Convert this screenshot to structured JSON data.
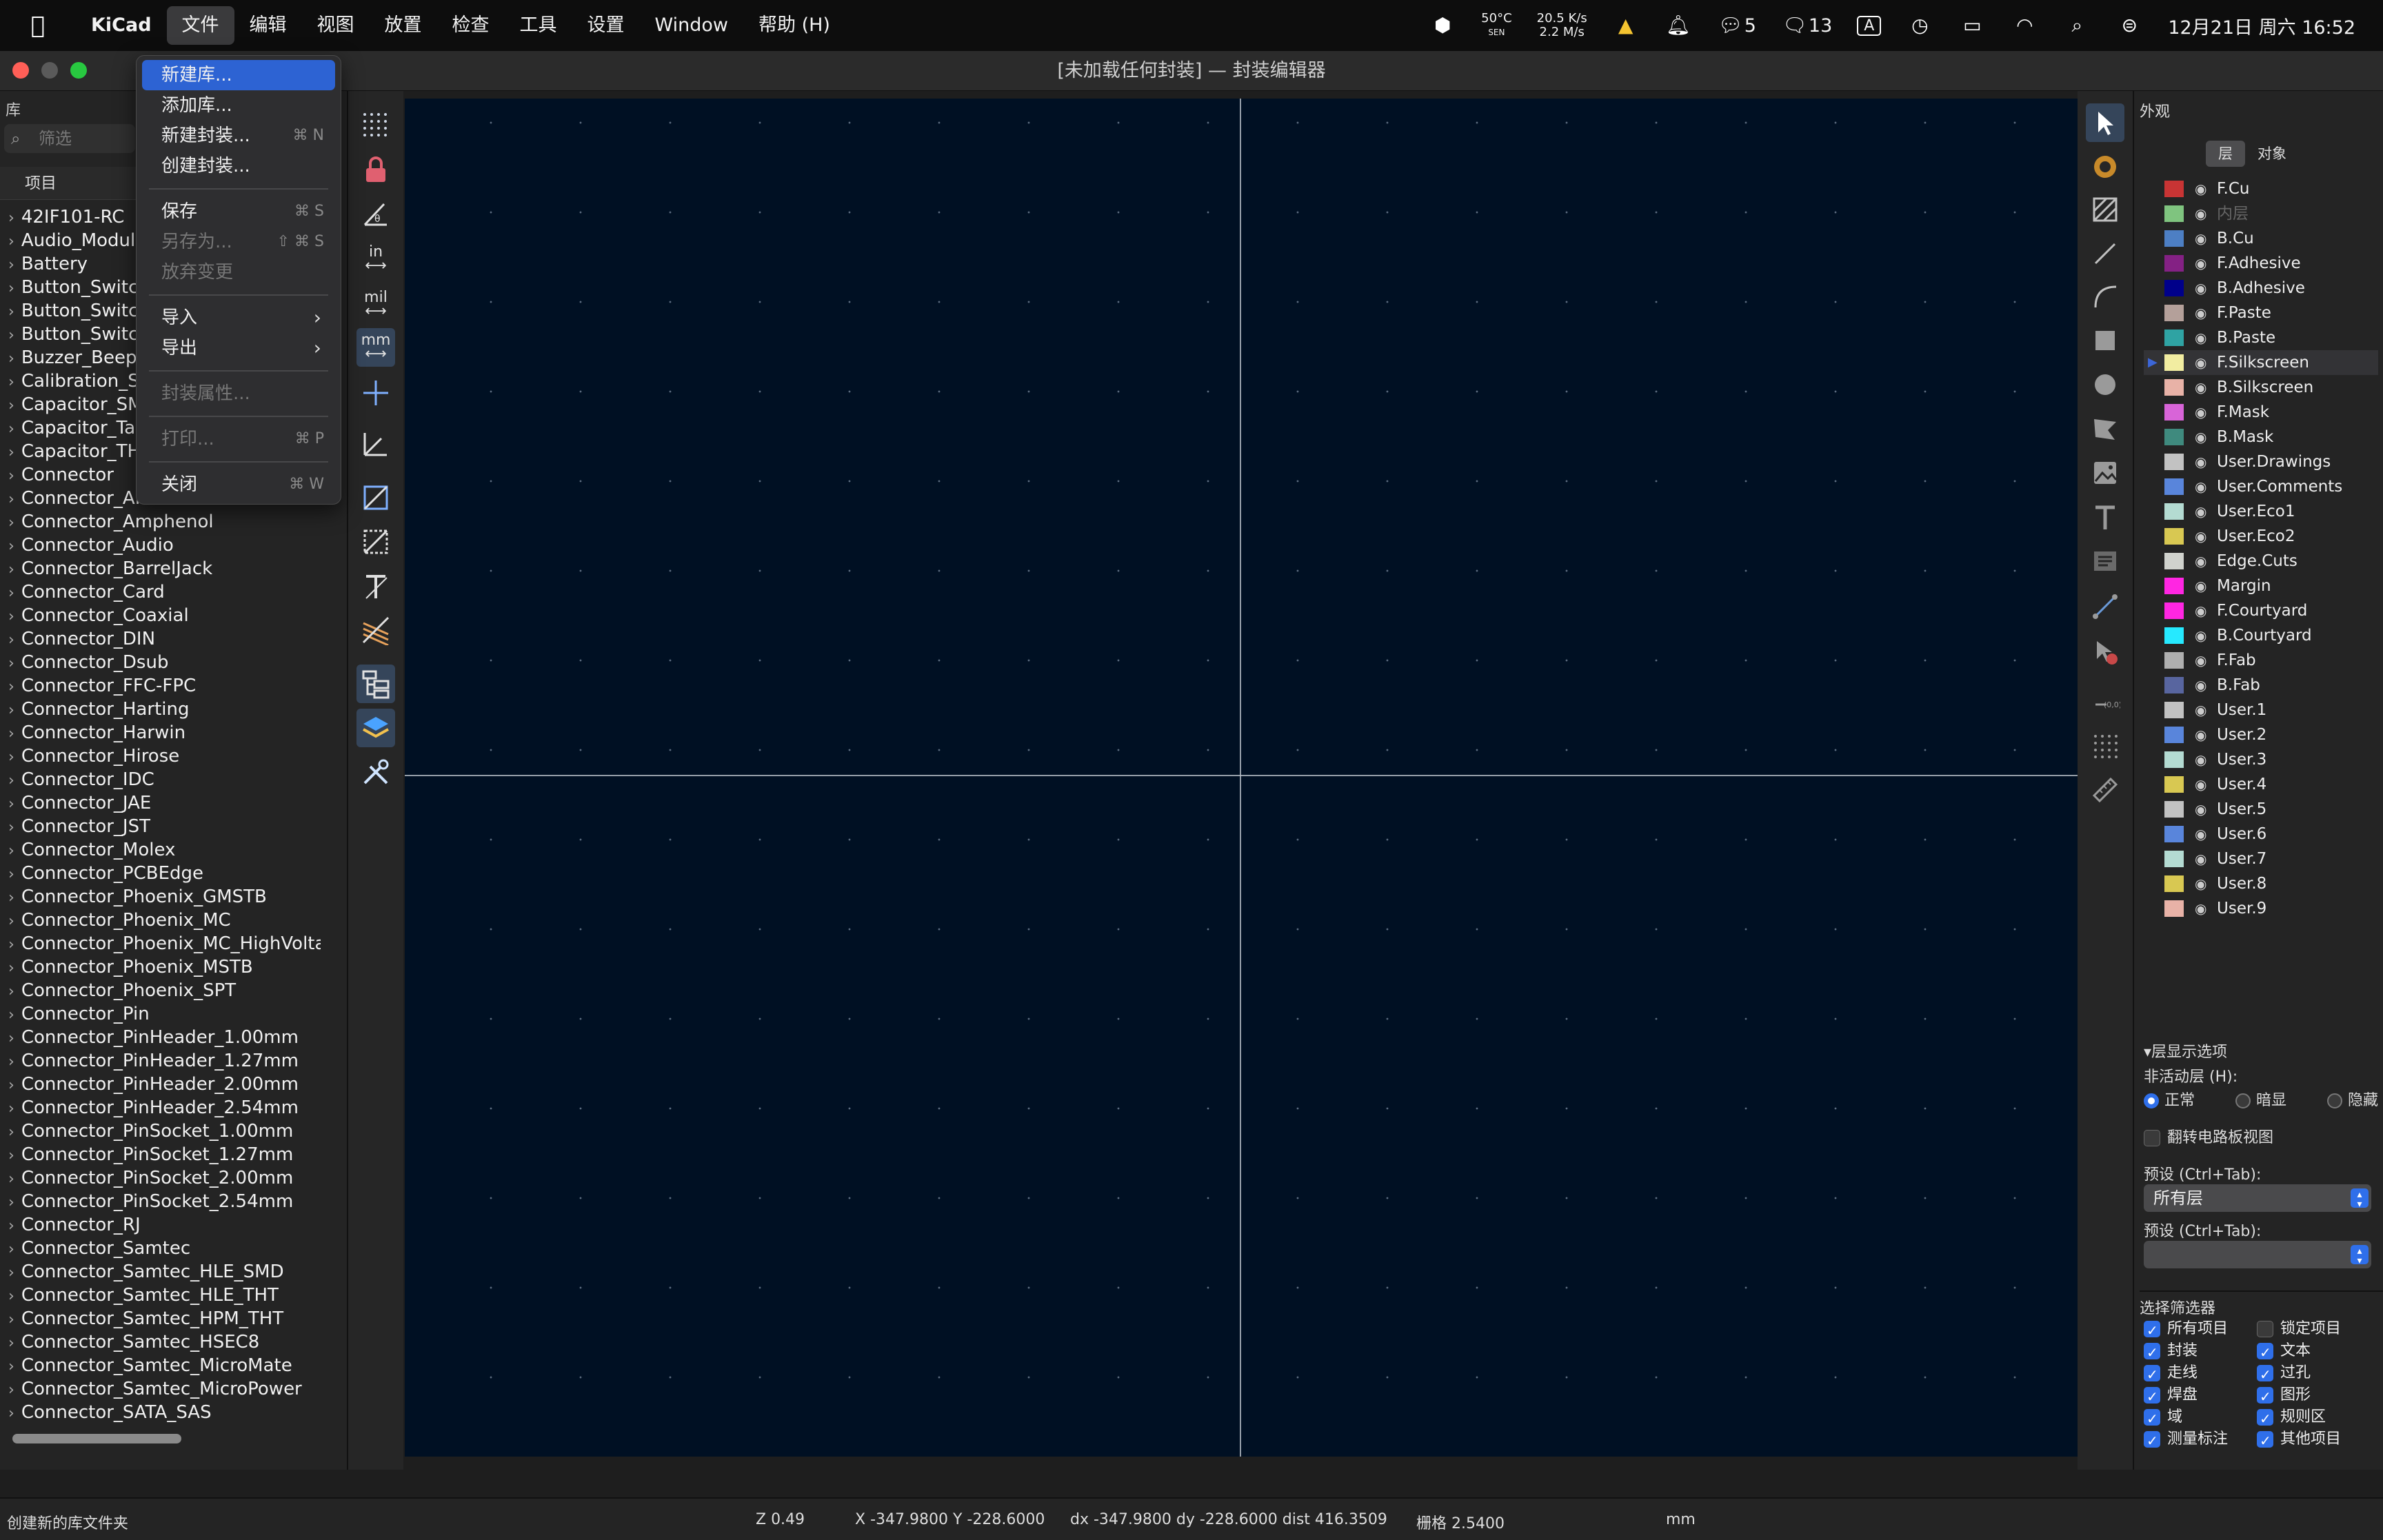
{
  "menubar": {
    "app": "KiCad",
    "items": [
      "文件",
      "编辑",
      "视图",
      "放置",
      "检查",
      "工具",
      "设置",
      "Window",
      "帮助 (H)"
    ],
    "status": {
      "temp": "50°C",
      "temp_sub": "SEN",
      "net_up": "20.5 K/s",
      "net_down": "2.2 M/s",
      "wechat_count": "5",
      "chat_count": "13",
      "input": "A",
      "datetime": "12月21日 周六  16:52"
    }
  },
  "window": {
    "title": "[未加载任何封装] — 封装编辑器"
  },
  "library": {
    "title": "库",
    "filter_placeholder": "筛选",
    "column": "项目",
    "items": [
      "42IF101-RC",
      "Audio_Module",
      "Battery",
      "Button_Switch",
      "Button_Switch",
      "Button_Switch",
      "Buzzer_Beeper",
      "Calibration_Scale",
      "Capacitor_SMD",
      "Capacitor_Tantalum",
      "Capacitor_THT",
      "Connector",
      "Connector_AMASS",
      "Connector_Amphenol",
      "Connector_Audio",
      "Connector_BarrelJack",
      "Connector_Card",
      "Connector_Coaxial",
      "Connector_DIN",
      "Connector_Dsub",
      "Connector_FFC-FPC",
      "Connector_Harting",
      "Connector_Harwin",
      "Connector_Hirose",
      "Connector_IDC",
      "Connector_JAE",
      "Connector_JST",
      "Connector_Molex",
      "Connector_PCBEdge",
      "Connector_Phoenix_GMSTB",
      "Connector_Phoenix_MC",
      "Connector_Phoenix_MC_HighVoltage",
      "Connector_Phoenix_MSTB",
      "Connector_Phoenix_SPT",
      "Connector_Pin",
      "Connector_PinHeader_1.00mm",
      "Connector_PinHeader_1.27mm",
      "Connector_PinHeader_2.00mm",
      "Connector_PinHeader_2.54mm",
      "Connector_PinSocket_1.00mm",
      "Connector_PinSocket_1.27mm",
      "Connector_PinSocket_2.00mm",
      "Connector_PinSocket_2.54mm",
      "Connector_RJ",
      "Connector_Samtec",
      "Connector_Samtec_HLE_SMD",
      "Connector_Samtec_HLE_THT",
      "Connector_Samtec_HPM_THT",
      "Connector_Samtec_HSEC8",
      "Connector_Samtec_MicroMate",
      "Connector_Samtec_MicroPower",
      "Connector_SATA_SAS"
    ]
  },
  "file_menu": {
    "items": [
      {
        "label": "新建库...",
        "shortcut": "",
        "state": "selected"
      },
      {
        "label": "添加库...",
        "shortcut": "",
        "state": "normal"
      },
      {
        "label": "新建封装...",
        "shortcut": "⌘ N",
        "state": "normal"
      },
      {
        "label": "创建封装...",
        "shortcut": "",
        "state": "normal"
      },
      {
        "label": "保存",
        "shortcut": "⌘ S",
        "state": "normal"
      },
      {
        "label": "另存为...",
        "shortcut": "⇧ ⌘ S",
        "state": "disabled"
      },
      {
        "label": "放弃变更",
        "shortcut": "",
        "state": "disabled"
      },
      {
        "label": "导入",
        "shortcut": "",
        "state": "submenu"
      },
      {
        "label": "导出",
        "shortcut": "",
        "state": "submenu"
      },
      {
        "label": "封装属性...",
        "shortcut": "",
        "state": "disabled"
      },
      {
        "label": "打印...",
        "shortcut": "⌘ P",
        "state": "disabled"
      },
      {
        "label": "关闭",
        "shortcut": "⌘ W",
        "state": "normal"
      }
    ]
  },
  "left_tools": {
    "in_label": "in",
    "mil_label": "mil",
    "mm_label": "mm"
  },
  "appearance": {
    "title": "外观",
    "tabs": [
      "层",
      "对象"
    ],
    "layers": [
      {
        "name": "F.Cu",
        "color": "#c83434"
      },
      {
        "name": "内层",
        "color": "#7fc47f",
        "dim": true
      },
      {
        "name": "B.Cu",
        "color": "#4d7fc4"
      },
      {
        "name": "F.Adhesive",
        "color": "#842184"
      },
      {
        "name": "B.Adhesive",
        "color": "#00008a"
      },
      {
        "name": "F.Paste",
        "color": "#b4a09a"
      },
      {
        "name": "B.Paste",
        "color": "#2fa3a3"
      },
      {
        "name": "F.Silkscreen",
        "color": "#f2eda1",
        "selected": true
      },
      {
        "name": "B.Silkscreen",
        "color": "#e8b2a7"
      },
      {
        "name": "F.Mask",
        "color": "#d864d8"
      },
      {
        "name": "B.Mask",
        "color": "#3f8a7e"
      },
      {
        "name": "User.Drawings",
        "color": "#c2c2c2"
      },
      {
        "name": "User.Comments",
        "color": "#5985db"
      },
      {
        "name": "User.Eco1",
        "color": "#b4dbd2"
      },
      {
        "name": "User.Eco2",
        "color": "#d8c852"
      },
      {
        "name": "Edge.Cuts",
        "color": "#d0d2cd"
      },
      {
        "name": "Margin",
        "color": "#ff26e2"
      },
      {
        "name": "F.Courtyard",
        "color": "#ff26e2"
      },
      {
        "name": "B.Courtyard",
        "color": "#26e9ff"
      },
      {
        "name": "F.Fab",
        "color": "#afafaf"
      },
      {
        "name": "B.Fab",
        "color": "#58659f"
      },
      {
        "name": "User.1",
        "color": "#c2c2c2"
      },
      {
        "name": "User.2",
        "color": "#5985db"
      },
      {
        "name": "User.3",
        "color": "#b4dbd2"
      },
      {
        "name": "User.4",
        "color": "#d8c852"
      },
      {
        "name": "User.5",
        "color": "#c2c2c2"
      },
      {
        "name": "User.6",
        "color": "#5985db"
      },
      {
        "name": "User.7",
        "color": "#b4dbd2"
      },
      {
        "name": "User.8",
        "color": "#d8c852"
      },
      {
        "name": "User.9",
        "color": "#e8b2a7"
      }
    ],
    "display_options": "层显示选项",
    "inactive_layers": "非活动层 (H):",
    "inactive_opts": [
      "正常",
      "暗显",
      "隐藏"
    ],
    "flip_board": "翻转电路板视图",
    "preset_label": "预设 (Ctrl+Tab):",
    "preset_value": "所有层",
    "preset_label2": "预设 (Ctrl+Tab):",
    "selection_filter_title": "选择筛选器",
    "filters": [
      {
        "label": "所有项目",
        "checked": true
      },
      {
        "label": "锁定项目",
        "checked": false
      },
      {
        "label": "封装",
        "checked": true
      },
      {
        "label": "文本",
        "checked": true
      },
      {
        "label": "走线",
        "checked": true
      },
      {
        "label": "过孔",
        "checked": true
      },
      {
        "label": "焊盘",
        "checked": true
      },
      {
        "label": "图形",
        "checked": true
      },
      {
        "label": "域",
        "checked": true
      },
      {
        "label": "规则区",
        "checked": true
      },
      {
        "label": "测量标注",
        "checked": true
      },
      {
        "label": "其他项目",
        "checked": true
      }
    ]
  },
  "statusbar": {
    "message": "创建新的库文件夹",
    "zoom": "Z 0.49",
    "coords": "X -347.9800  Y -228.6000",
    "delta": "dx -347.9800  dy -228.6000  dist 416.3509",
    "grid": "栅格 2.5400",
    "units": "mm"
  }
}
